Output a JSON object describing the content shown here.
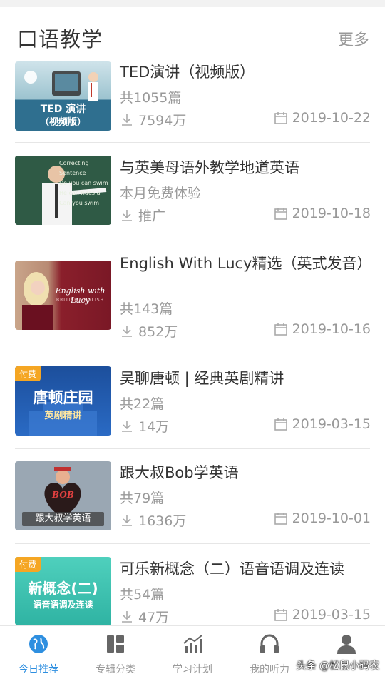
{
  "header": {
    "title": "口语教学",
    "more": "更多"
  },
  "items": [
    {
      "title": "TED演讲（视频版）",
      "subtitle": "共1055篇",
      "downloads": "7594万",
      "date": "2019-10-22",
      "thumb_caption": "TED 演讲",
      "thumb_caption2": "（视频版）",
      "thumb_color": "#2f6f8f"
    },
    {
      "title": "与英美母语外教学地道英语",
      "subtitle": "本月免费体验",
      "downloads": "推广",
      "date": "2019-10-18",
      "thumb_board": [
        "Correcting Sentence",
        "Do you can swim",
        "He can rides a",
        "Can you swim"
      ],
      "thumb_color": "#2b4a3a"
    },
    {
      "title": "English With Lucy精选（英式发音）",
      "subtitle": "共143篇",
      "downloads": "852万",
      "date": "2019-10-16",
      "thumb_caption": "English with Lucy",
      "thumb_caption2": "BRITISH ENGLISH",
      "thumb_color": "#8a1f2b"
    },
    {
      "title": "吴聊唐顿 | 经典英剧精讲",
      "subtitle": "共22篇",
      "downloads": "14万",
      "date": "2019-03-15",
      "tag": "付费",
      "thumb_caption": "唐顿庄园",
      "thumb_caption2": "英剧精讲",
      "thumb_color": "#1f5aa8"
    },
    {
      "title": "跟大叔Bob学英语",
      "subtitle": "共79篇",
      "downloads": "1636万",
      "date": "2019-10-01",
      "thumb_caption": "跟大叔学英语",
      "thumb_caption2": "BOB",
      "thumb_color": "#9aa7b3"
    },
    {
      "title": "可乐新概念（二）语音语调及连读",
      "subtitle": "共54篇",
      "downloads": "47万",
      "date": "2019-03-15",
      "tag": "付费",
      "thumb_caption": "新概念(二)",
      "thumb_caption2": "语音语调及连读",
      "thumb_color": "#3bbfae"
    }
  ],
  "tabs": [
    {
      "label": "今日推荐",
      "icon": "globe-icon",
      "active": true
    },
    {
      "label": "专辑分类",
      "icon": "grid-icon",
      "active": false
    },
    {
      "label": "学习计划",
      "icon": "chart-icon",
      "active": false
    },
    {
      "label": "我的听力",
      "icon": "headphones-icon",
      "active": false
    },
    {
      "label": "",
      "icon": "user-icon",
      "active": false
    }
  ],
  "watermark": "头条 @松鼠小码农",
  "colors": {
    "accent": "#2e8fe0",
    "muted": "#999999",
    "tag": "#f5a623"
  }
}
